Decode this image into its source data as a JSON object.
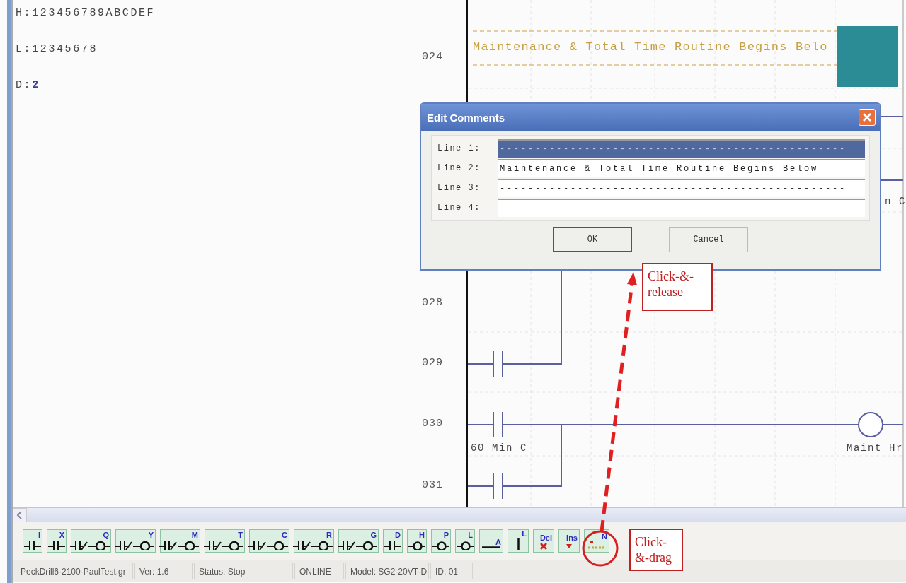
{
  "registers": [
    {
      "label": "H:",
      "value": "123456789ABCDEF",
      "highlight": false
    },
    {
      "label": "L:",
      "value": "12345678",
      "highlight": false
    },
    {
      "label": "D:",
      "value": "2",
      "highlight": true
    }
  ],
  "ladder": {
    "comment": "Maintenance & Total Time Routine Begins Belo",
    "rungs": [
      {
        "number": "024"
      },
      {
        "number": "028"
      },
      {
        "number": "029"
      },
      {
        "number": "030"
      },
      {
        "number": "031"
      }
    ],
    "labels": [
      {
        "text": "n C",
        "kind": "partial"
      },
      {
        "text": "60 Min C",
        "kind": "contact"
      },
      {
        "text": "Maint Hr",
        "kind": "coil"
      }
    ]
  },
  "dialog": {
    "title": "Edit Comments",
    "fields": [
      {
        "label": "Line 1:",
        "value": "-------------------------------------------------",
        "selected": true
      },
      {
        "label": "Line 2:",
        "value": "Maintenance & Total Time Routine Begins Below",
        "selected": false
      },
      {
        "label": "Line 3:",
        "value": "-------------------------------------------------",
        "selected": false
      },
      {
        "label": "Line 4:",
        "selected": false
      }
    ],
    "buttons": [
      {
        "label": "OK",
        "selected": true
      },
      {
        "label": "Cancel",
        "selected": false
      }
    ]
  },
  "annotations": [
    {
      "text": "Click-&-release",
      "kind": "target"
    },
    {
      "text": "Click-&-drag",
      "kind": "source"
    }
  ],
  "toolbar": [
    {
      "label": "I",
      "kind": "contact"
    },
    {
      "label": "X",
      "kind": "contact"
    },
    {
      "label": "Q",
      "kind": "contact-coil"
    },
    {
      "label": "Y",
      "kind": "contact-coil"
    },
    {
      "label": "M",
      "kind": "contact-coil"
    },
    {
      "label": "T",
      "kind": "contact-coil"
    },
    {
      "label": "C",
      "kind": "contact-coil"
    },
    {
      "label": "R",
      "kind": "contact-coil"
    },
    {
      "label": "G",
      "kind": "contact-coil"
    },
    {
      "label": "D",
      "kind": "contact"
    },
    {
      "label": "H",
      "kind": "coil"
    },
    {
      "label": "P",
      "kind": "coil"
    },
    {
      "label": "L",
      "kind": "coil"
    },
    {
      "label": "A",
      "kind": "hline"
    },
    {
      "label": "L",
      "kind": "vline"
    },
    {
      "label": "Del",
      "kind": "delete"
    },
    {
      "label": "Ins",
      "kind": "insert"
    },
    {
      "label": "N",
      "kind": "note"
    }
  ],
  "status_bar": [
    "PeckDrill6-2100-PaulTest.gr",
    "Ver: 1.6",
    "Status: Stop",
    "ONLINE",
    "Model: SG2-20VT-D",
    "ID: 01"
  ]
}
